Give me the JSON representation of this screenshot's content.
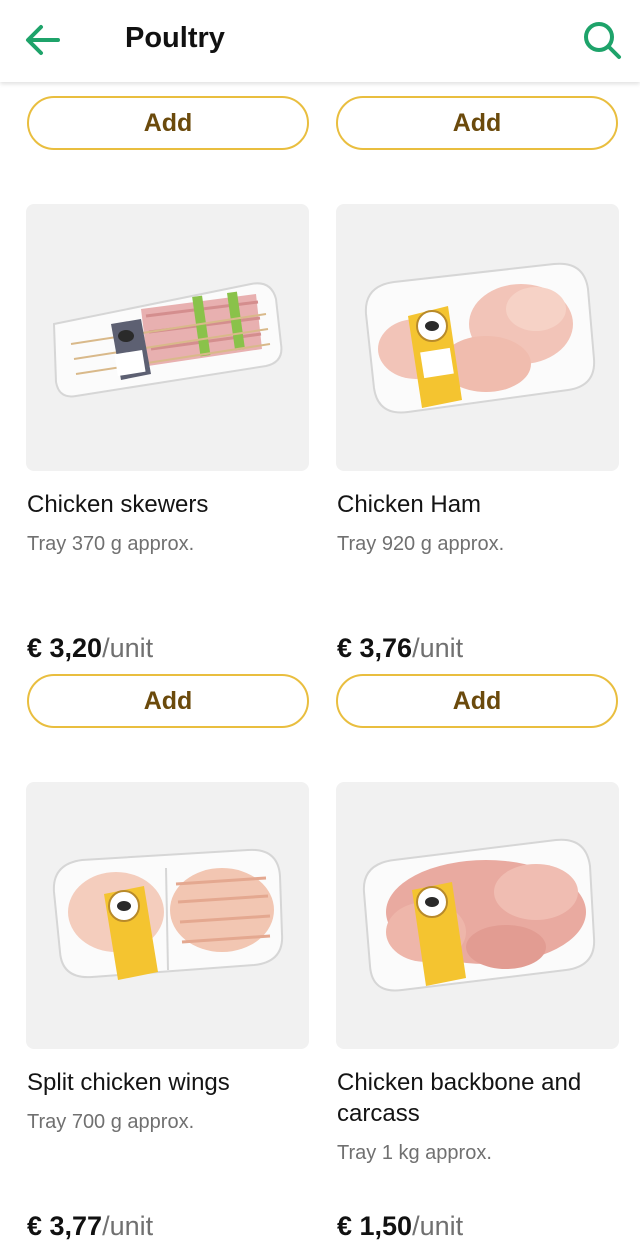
{
  "header": {
    "title": "Poultry",
    "back_icon": "arrow-left-icon",
    "search_icon": "search-icon",
    "accent_color": "#1ea36a"
  },
  "add_label": "Add",
  "colors": {
    "button_border": "#e9be3f",
    "button_text": "#6b4a0c",
    "label_yellow": "#f4c430",
    "image_bg": "#f1f1f1"
  },
  "products": [
    {
      "name": "Chicken skewers",
      "description": "Tray 370 g approx.",
      "price": "€ 3,20",
      "unit": "/unit"
    },
    {
      "name": "Chicken Ham",
      "description": "Tray 920 g approx.",
      "price": "€ 3,76",
      "unit": "/unit"
    },
    {
      "name": "Split chicken wings",
      "description": "Tray 700 g approx.",
      "price": "€ 3,77",
      "unit": "/unit"
    },
    {
      "name": "Chicken backbone and carcass",
      "description": "Tray 1 kg approx.",
      "price": "€ 1,50",
      "unit": "/unit"
    }
  ]
}
